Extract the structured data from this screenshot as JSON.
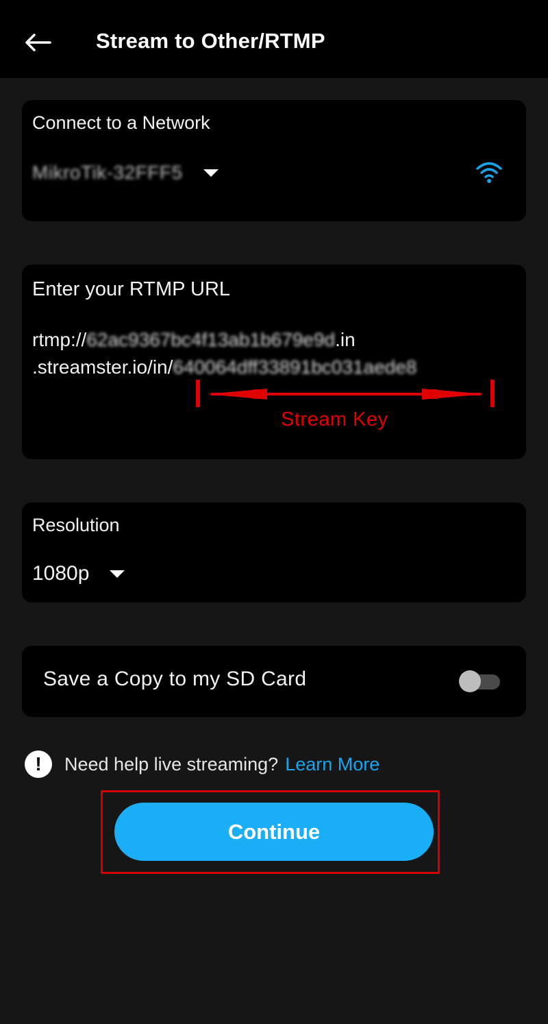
{
  "header": {
    "title": "Stream to Other/RTMP"
  },
  "network": {
    "label": "Connect to a Network",
    "selected": "MikroTik-32FFF5"
  },
  "rtmp": {
    "label": "Enter your RTMP URL",
    "url_prefix": "rtmp://",
    "url_host_blurred": "62ac9367bc4f13ab1b679e9d",
    "url_line1_suffix": ".in",
    "url_line2_prefix": ".streamster.io/in/",
    "stream_key_blurred": "640064dff33891bc031aede8",
    "annotation_label": "Stream Key",
    "annotation_color": "#e00000"
  },
  "resolution": {
    "label": "Resolution",
    "selected": "1080p"
  },
  "sd_card": {
    "label": "Save a Copy to my SD Card",
    "enabled": false
  },
  "help": {
    "icon_glyph": "!",
    "text": "Need help live streaming?",
    "link": "Learn More"
  },
  "actions": {
    "continue_label": "Continue"
  },
  "colors": {
    "accent": "#1aaef6",
    "link": "#1aa4ec",
    "highlight": "#d40000"
  }
}
